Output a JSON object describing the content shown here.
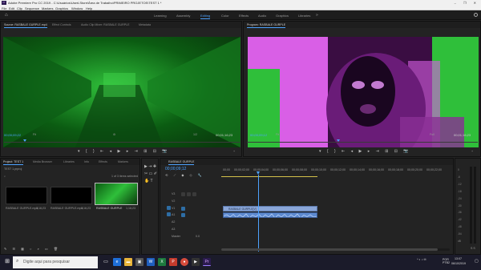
{
  "app": {
    "logo": "Pr",
    "window_title": "Adobe Premiere Pro CC 2019 - C:\\Usuários\\UserLStore\\Área de Trabalho\\PRIMEIRO PROJETOS\\TEST 1 *",
    "window_controls": "– ❐ ✕"
  },
  "menu": [
    "File",
    "Edit",
    "Clip",
    "Sequence",
    "Markers",
    "Graphics",
    "Window",
    "Help"
  ],
  "workspaces": {
    "tabs": [
      "Learning",
      "Assembly",
      "Editing",
      "Color",
      "Effects",
      "Audio",
      "Graphics",
      "Libraries"
    ],
    "active": "Editing",
    "more": "»"
  },
  "source_monitor": {
    "tabs": [
      "Source: RASBALE GURPLE.mp4",
      "Effect Controls",
      "Audio Clip Mixer: RASBALE GURPLE",
      "Metadata"
    ],
    "timecode_in": "00;00;09;22",
    "fit": "Fit",
    "resolution": "1/2",
    "timecode_dur": "00;01;16;23",
    "video_colors": [
      "#0b5c12",
      "#2fbf3a",
      "#0a3a0d"
    ]
  },
  "program_monitor": {
    "tabs": [
      "Program: RASBALE GURPLE"
    ],
    "timecode_in": "00;00;09;12",
    "fit": "Fit",
    "resolution": "Full",
    "timecode_dur": "00;01;16;23",
    "video_colors": [
      "#d95fe6",
      "#2fbf3a",
      "#3a0d42"
    ]
  },
  "project_panel": {
    "tabs": [
      "Project: TEST 1",
      "Media Browser",
      "Libraries",
      "Info",
      "Effects",
      "Markers"
    ],
    "path": "TEST 1.prproj",
    "items_info": "1 of 3 items selected",
    "items": [
      {
        "name": "RASBALE GURPLE.mp4",
        "dur": "1;16;23",
        "color": "#000000"
      },
      {
        "name": "RASBALE GURPLE.mp4",
        "dur": "1;16;23",
        "color": "#000000"
      },
      {
        "name": "RASBALE GURPLE",
        "dur": "1;16;23",
        "color": "#2fbf3a"
      }
    ]
  },
  "timeline": {
    "tab": "RASBALE GURPLE",
    "timecode": "00;00;09;12",
    "ruler": [
      "00;00",
      "00;00;02;00",
      "00;00;04;00",
      "00;00;06;00",
      "00;00;08;00",
      "00;00;10;00",
      "00;00;12;00",
      "00;00;14;00",
      "00;00;16;00",
      "00;00;18;00",
      "00;00;20;00",
      "00;00;22;00"
    ],
    "tracks": [
      {
        "id": "V3"
      },
      {
        "id": "V2"
      },
      {
        "id": "V1"
      },
      {
        "id": "A1"
      },
      {
        "id": "A2"
      },
      {
        "id": "A3"
      }
    ],
    "video_clip": "RASBALE GURPLE[V]",
    "master_label": "Master",
    "master_value": "0.0",
    "clip_color": "#8aa6d8"
  },
  "meter": {
    "labels": [
      "0",
      "-6",
      "-12",
      "-18",
      "-24",
      "-30",
      "-36",
      "-42",
      "-48",
      "-54",
      "dB"
    ]
  },
  "taskbar": {
    "search_placeholder": "Digite aqui para pesquisar",
    "lang": "POR\nPTB2",
    "time": "13:07",
    "date": "06/10/2019"
  }
}
